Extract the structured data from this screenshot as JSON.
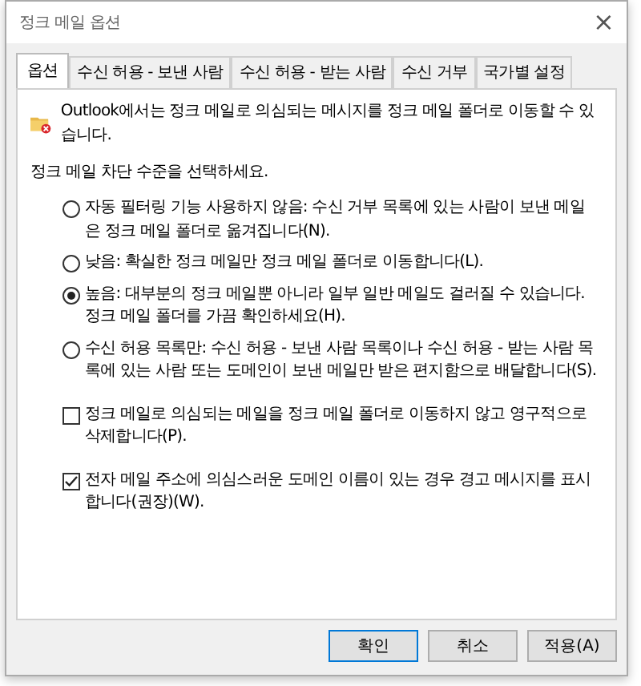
{
  "window": {
    "title": "정크 메일 옵션",
    "close": "×"
  },
  "tabs": [
    {
      "label": "옵션",
      "selected": true
    },
    {
      "label": "수신 허용 - 보낸 사람",
      "selected": false
    },
    {
      "label": "수신 허용 - 받는 사람",
      "selected": false
    },
    {
      "label": "수신 거부",
      "selected": false
    },
    {
      "label": "국가별 설정",
      "selected": false
    }
  ],
  "intro": "Outlook에서는 정크 메일로 의심되는 메시지를 정크 메일 폴더로 이동할 수 있습니다.",
  "prompt": "정크 메일 차단 수준을 선택하세요.",
  "options": [
    {
      "kind": "radio",
      "label": "자동 필터링 기능 사용하지 않음: 수신 거부 목록에 있는 사람이 보낸 메일은 정크 메일 폴더로 옮겨집니다(N).",
      "selected": false
    },
    {
      "kind": "radio",
      "label": "낮음: 확실한 정크 메일만 정크 메일 폴더로 이동합니다(L).",
      "selected": false
    },
    {
      "kind": "radio",
      "label": "높음: 대부분의 정크 메일뿐 아니라 일부 일반 메일도 걸러질 수 있습니다. 정크 메일 폴더를 가끔 확인하세요(H).",
      "selected": true
    },
    {
      "kind": "radio",
      "label": "수신 허용 목록만: 수신 허용 - 보낸 사람 목록이나 수신 허용 - 받는 사람 목록에 있는 사람 또는 도메인이 보낸 메일만 받은 편지함으로 배달합니다(S).",
      "selected": false
    },
    {
      "kind": "checkbox",
      "label": "정크 메일로 의심되는 메일을 정크 메일 폴더로 이동하지 않고 영구적으로 삭제합니다(P).",
      "checked": false
    },
    {
      "kind": "checkbox",
      "label": "전자 메일 주소에 의심스러운 도메인 이름이 있는 경우 경고 메시지를 표시합니다(권장)(W).",
      "checked": true
    }
  ],
  "buttons": [
    {
      "label": "확인",
      "default": true
    },
    {
      "label": "취소",
      "default": false
    },
    {
      "label": "적용(A)",
      "default": false
    }
  ]
}
